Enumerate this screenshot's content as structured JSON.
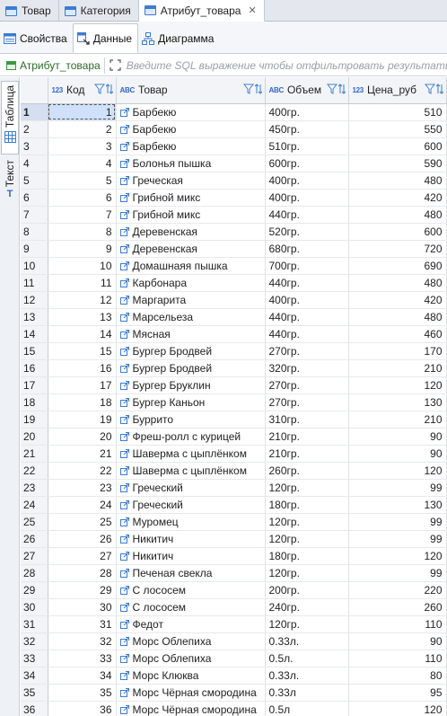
{
  "editor_tabs": [
    {
      "label": "Товар",
      "active": false
    },
    {
      "label": "Категория",
      "active": false
    },
    {
      "label": "Атрибут_товара",
      "active": true
    }
  ],
  "view_tabs": [
    {
      "label": "Свойства",
      "icon": "properties-icon"
    },
    {
      "label": "Данные",
      "icon": "data-icon",
      "active": true
    },
    {
      "label": "Диаграмма",
      "icon": "diagram-icon"
    }
  ],
  "filter": {
    "entity": "Атрибут_товара",
    "placeholder": "Введите SQL выражение чтобы отфильтровать результаты"
  },
  "side_tabs": {
    "table": "Таблица",
    "text": "Текст"
  },
  "colors": {
    "accent": "#3366cc",
    "selected_row": "#d5dff0"
  },
  "columns": [
    {
      "type": "123",
      "name": "Код"
    },
    {
      "type": "ABC",
      "name": "Товар"
    },
    {
      "type": "ABC",
      "name": "Объем"
    },
    {
      "type": "123",
      "name": "Цена_руб"
    }
  ],
  "rows": [
    {
      "n": "1",
      "kod": "1",
      "tovar": "Барбекю",
      "obem": "400гр.",
      "cena": "510"
    },
    {
      "n": "2",
      "kod": "2",
      "tovar": "Барбекю",
      "obem": "450гр.",
      "cena": "550"
    },
    {
      "n": "3",
      "kod": "3",
      "tovar": "Барбекю",
      "obem": "510гр.",
      "cena": "600"
    },
    {
      "n": "4",
      "kod": "4",
      "tovar": "Болонья пышка",
      "obem": "600гр.",
      "cena": "590"
    },
    {
      "n": "5",
      "kod": "5",
      "tovar": "Греческая",
      "obem": "400гр.",
      "cena": "480"
    },
    {
      "n": "6",
      "kod": "6",
      "tovar": "Грибной микс",
      "obem": "400гр.",
      "cena": "420"
    },
    {
      "n": "7",
      "kod": "7",
      "tovar": "Грибной микс",
      "obem": "440гр.",
      "cena": "480"
    },
    {
      "n": "8",
      "kod": "8",
      "tovar": "Деревенская",
      "obem": "520гр.",
      "cena": "600"
    },
    {
      "n": "9",
      "kod": "9",
      "tovar": "Деревенская",
      "obem": "680гр.",
      "cena": "720"
    },
    {
      "n": "10",
      "kod": "10",
      "tovar": "Домашнаяя пышка",
      "obem": "700гр.",
      "cena": "690"
    },
    {
      "n": "11",
      "kod": "11",
      "tovar": "Карбонара",
      "obem": "440гр.",
      "cena": "480"
    },
    {
      "n": "12",
      "kod": "12",
      "tovar": "Маргарита",
      "obem": "400гр.",
      "cena": "420"
    },
    {
      "n": "13",
      "kod": "13",
      "tovar": "Марсельеза",
      "obem": "440гр.",
      "cena": "480"
    },
    {
      "n": "14",
      "kod": "14",
      "tovar": "Мясная",
      "obem": "440гр.",
      "cena": "460"
    },
    {
      "n": "15",
      "kod": "15",
      "tovar": "Бургер Бродвей",
      "obem": "270гр.",
      "cena": "170"
    },
    {
      "n": "16",
      "kod": "16",
      "tovar": "Бургер Бродвей",
      "obem": "320гр.",
      "cena": "210"
    },
    {
      "n": "17",
      "kod": "17",
      "tovar": "Бургер Бруклин",
      "obem": "270гр.",
      "cena": "120"
    },
    {
      "n": "18",
      "kod": "18",
      "tovar": "Бургер Каньон",
      "obem": "270гр.",
      "cena": "130"
    },
    {
      "n": "19",
      "kod": "19",
      "tovar": "Буррито",
      "obem": "310гр.",
      "cena": "210"
    },
    {
      "n": "20",
      "kod": "20",
      "tovar": "Фреш-ролл с курицей",
      "obem": "210гр.",
      "cena": "90"
    },
    {
      "n": "21",
      "kod": "21",
      "tovar": "Шаверма с цыплёнком",
      "obem": "210гр.",
      "cena": "90"
    },
    {
      "n": "22",
      "kod": "22",
      "tovar": "Шаверма с цыплёнком",
      "obem": "260гр.",
      "cena": "120"
    },
    {
      "n": "23",
      "kod": "23",
      "tovar": "Греческий",
      "obem": "120гр.",
      "cena": "99"
    },
    {
      "n": "24",
      "kod": "24",
      "tovar": "Греческий",
      "obem": "180гр.",
      "cena": "130"
    },
    {
      "n": "25",
      "kod": "25",
      "tovar": "Муромец",
      "obem": "120гр.",
      "cena": "99"
    },
    {
      "n": "26",
      "kod": "26",
      "tovar": "Никитич",
      "obem": "120гр.",
      "cena": "99"
    },
    {
      "n": "27",
      "kod": "27",
      "tovar": "Никитич",
      "obem": "180гр.",
      "cena": "120"
    },
    {
      "n": "28",
      "kod": "28",
      "tovar": "Печеная свекла",
      "obem": "120гр.",
      "cena": "99"
    },
    {
      "n": "29",
      "kod": "29",
      "tovar": "С лососем",
      "obem": "200гр.",
      "cena": "220"
    },
    {
      "n": "30",
      "kod": "30",
      "tovar": "С лососем",
      "obem": "240гр.",
      "cena": "260"
    },
    {
      "n": "31",
      "kod": "31",
      "tovar": "Федот",
      "obem": "120гр.",
      "cena": "110"
    },
    {
      "n": "32",
      "kod": "32",
      "tovar": "Морс Облепиха",
      "obem": "0.33л.",
      "cena": "90"
    },
    {
      "n": "33",
      "kod": "33",
      "tovar": "Морс Облепиха",
      "obem": "0.5л.",
      "cena": "110"
    },
    {
      "n": "34",
      "kod": "34",
      "tovar": "Морс Клюква",
      "obem": "0.33л.",
      "cena": "80"
    },
    {
      "n": "35",
      "kod": "35",
      "tovar": "Морс Чёрная смородина",
      "obem": "0.33л",
      "cena": "95"
    },
    {
      "n": "36",
      "kod": "36",
      "tovar": "Морс Чёрная смородина",
      "obem": "0.5л",
      "cena": "120"
    }
  ]
}
